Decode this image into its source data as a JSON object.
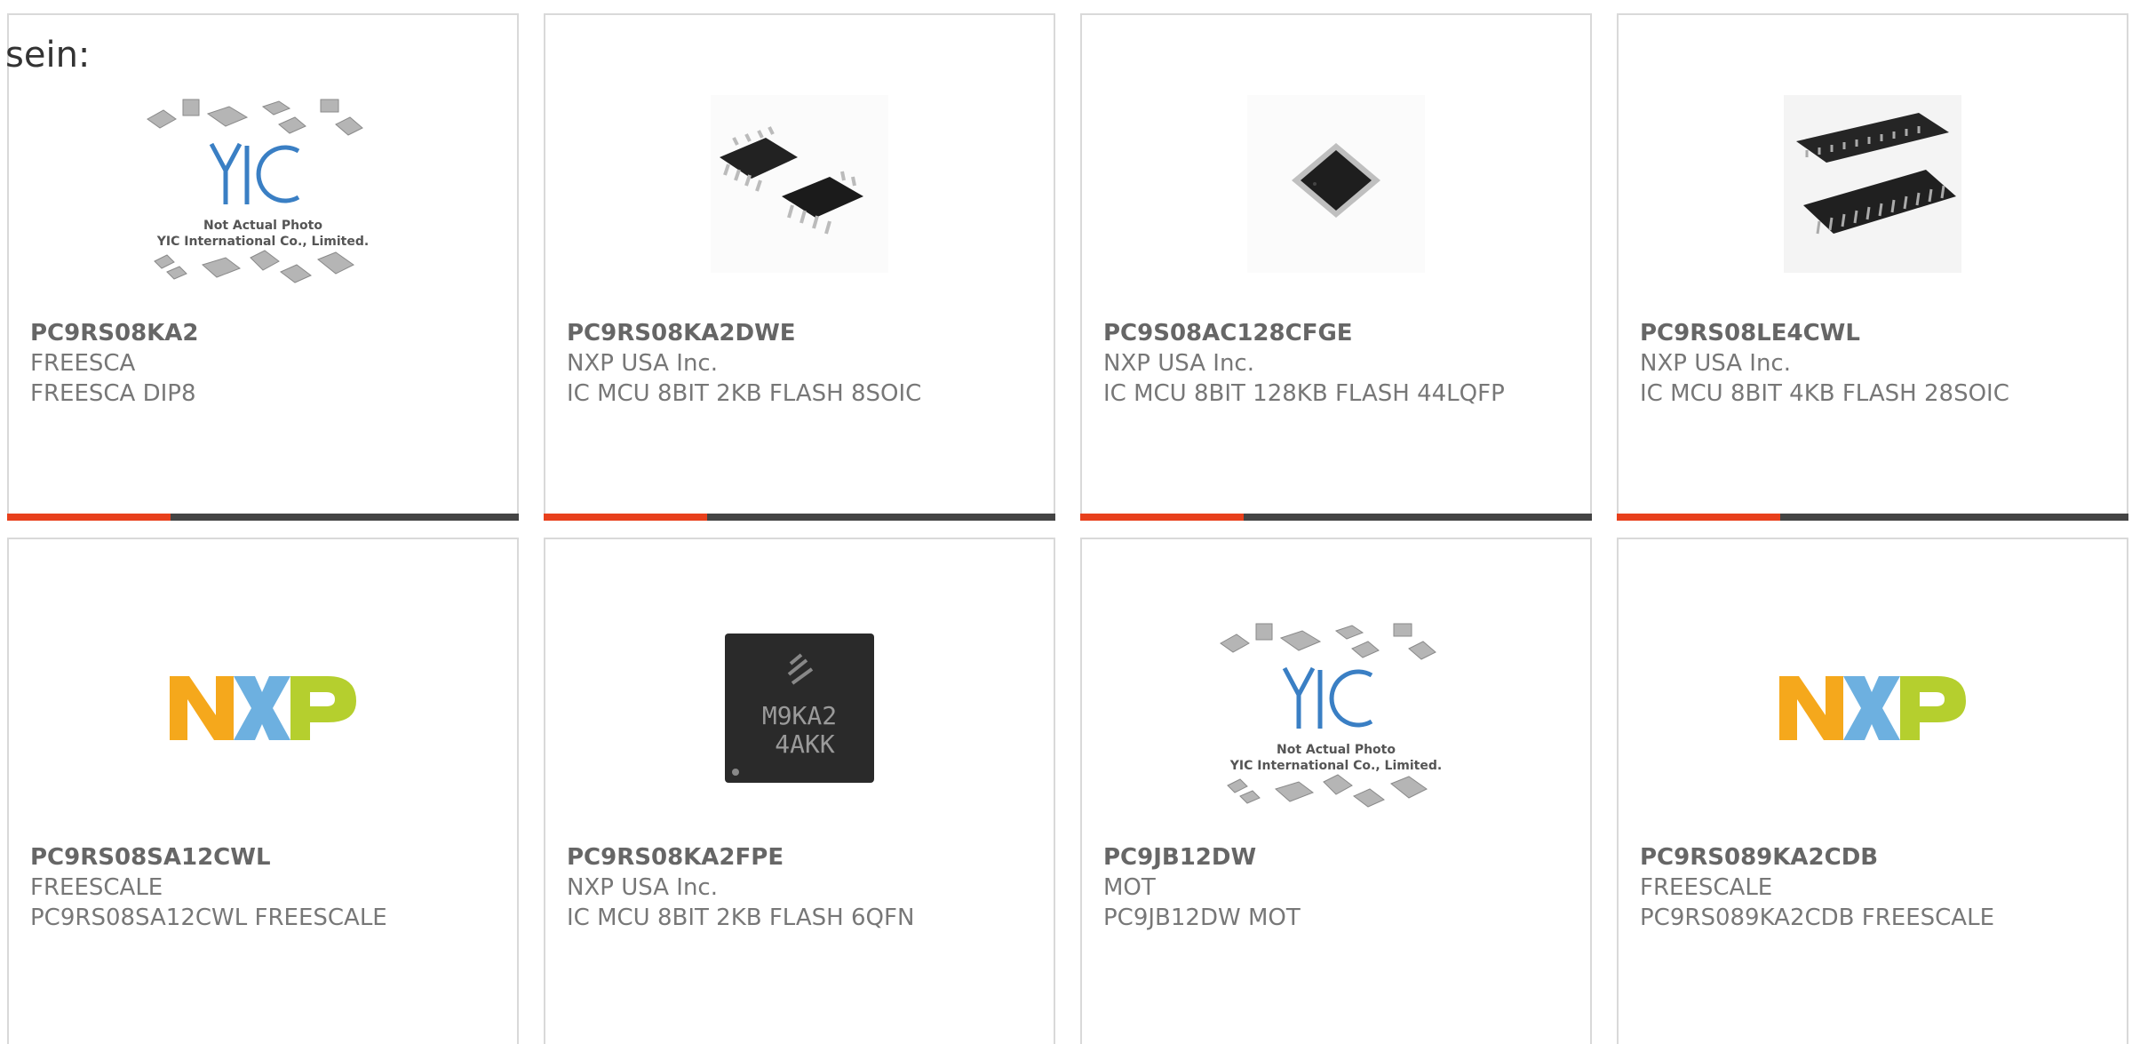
{
  "intro_text": "sein:",
  "colors": {
    "accent": "#e8401c",
    "bar_dark": "#444444",
    "border": "#d9d9d9"
  },
  "placeholder": {
    "line1": "Not Actual Photo",
    "line2": "YIC International Co., Limited.",
    "logo": "YIC"
  },
  "nxp_logo": "NXP",
  "chip_marking": {
    "line1": "M9KA2",
    "line2": "4AKK"
  },
  "products": [
    {
      "part": "PC9RS08KA2",
      "manufacturer": "FREESCA",
      "description": "FREESCA DIP8",
      "image": "placeholder-image"
    },
    {
      "part": "PC9RS08KA2DWE",
      "manufacturer": "NXP USA Inc.",
      "description": "IC MCU 8BIT 2KB FLASH 8SOIC",
      "image": "soic8-chips"
    },
    {
      "part": "PC9S08AC128CFGE",
      "manufacturer": "NXP USA Inc.",
      "description": "IC MCU 8BIT 128KB FLASH 44LQFP",
      "image": "lqfp-chip"
    },
    {
      "part": "PC9RS08LE4CWL",
      "manufacturer": "NXP USA Inc.",
      "description": "IC MCU 8BIT 4KB FLASH 28SOIC",
      "image": "soic28-chips"
    },
    {
      "part": "PC9RS08SA12CWL",
      "manufacturer": "FREESCALE",
      "description": "PC9RS08SA12CWL FREESCALE",
      "image": "nxp-logo"
    },
    {
      "part": "PC9RS08KA2FPE",
      "manufacturer": "NXP USA Inc.",
      "description": "IC MCU 8BIT 2KB FLASH 6QFN",
      "image": "qfn-chip"
    },
    {
      "part": "PC9JB12DW",
      "manufacturer": "MOT",
      "description": "PC9JB12DW MOT",
      "image": "placeholder-image"
    },
    {
      "part": "PC9RS089KA2CDB",
      "manufacturer": "FREESCALE",
      "description": "PC9RS089KA2CDB FREESCALE",
      "image": "nxp-logo"
    }
  ]
}
